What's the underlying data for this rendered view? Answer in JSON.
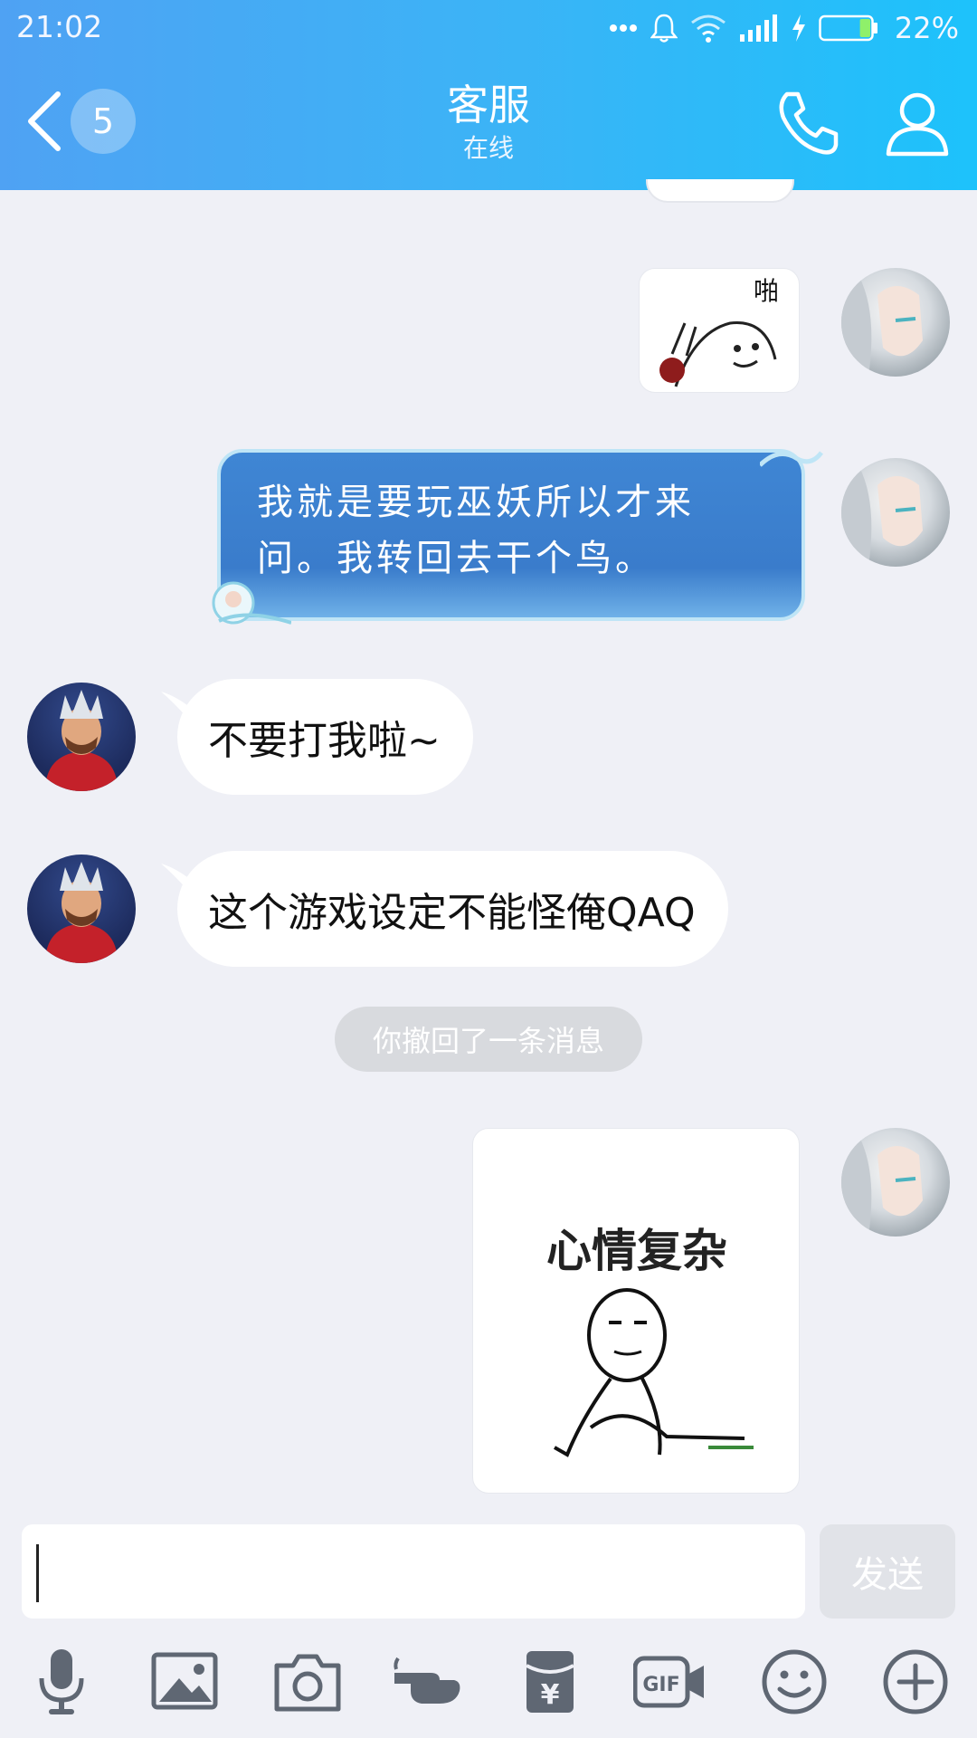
{
  "status_bar": {
    "time": "21:02",
    "battery_percent": "22%",
    "battery_level": 0.22,
    "icons": [
      "more-dots-icon",
      "bell-icon",
      "wifi-icon",
      "signal-icon",
      "charging-icon",
      "battery-icon"
    ]
  },
  "header": {
    "back_icon": "chevron-left-icon",
    "unread_count": "5",
    "title": "客服",
    "subtitle": "在线",
    "right_icons": [
      "phone-icon",
      "profile-icon"
    ],
    "gradient_colors": [
      "#4fa2f3",
      "#1dc2fb"
    ]
  },
  "messages": [
    {
      "side": "right",
      "type": "sticker",
      "sticker_text": "啪"
    },
    {
      "side": "right",
      "type": "fancy-bubble",
      "text": "我就是要玩巫妖所以才来问。我转回去干个鸟。"
    },
    {
      "side": "left",
      "type": "text",
      "text": "不要打我啦~"
    },
    {
      "side": "left",
      "type": "text",
      "text": "这个游戏设定不能怪俺QAQ"
    },
    {
      "side": "center",
      "type": "notice",
      "text": "你撤回了一条消息"
    },
    {
      "side": "right",
      "type": "sticker",
      "sticker_text": "心情复杂"
    }
  ],
  "input": {
    "value": "",
    "send_label": "发送"
  },
  "toolbar": {
    "icons": [
      "microphone-icon",
      "image-icon",
      "camera-icon",
      "poke-hand-icon",
      "red-packet-icon",
      "gif-icon",
      "emoji-icon",
      "plus-icon"
    ]
  },
  "colors": {
    "background": "#eff0f6",
    "icon_gray": "#5f6773",
    "fancy_bubble": "#3a7ccb"
  }
}
